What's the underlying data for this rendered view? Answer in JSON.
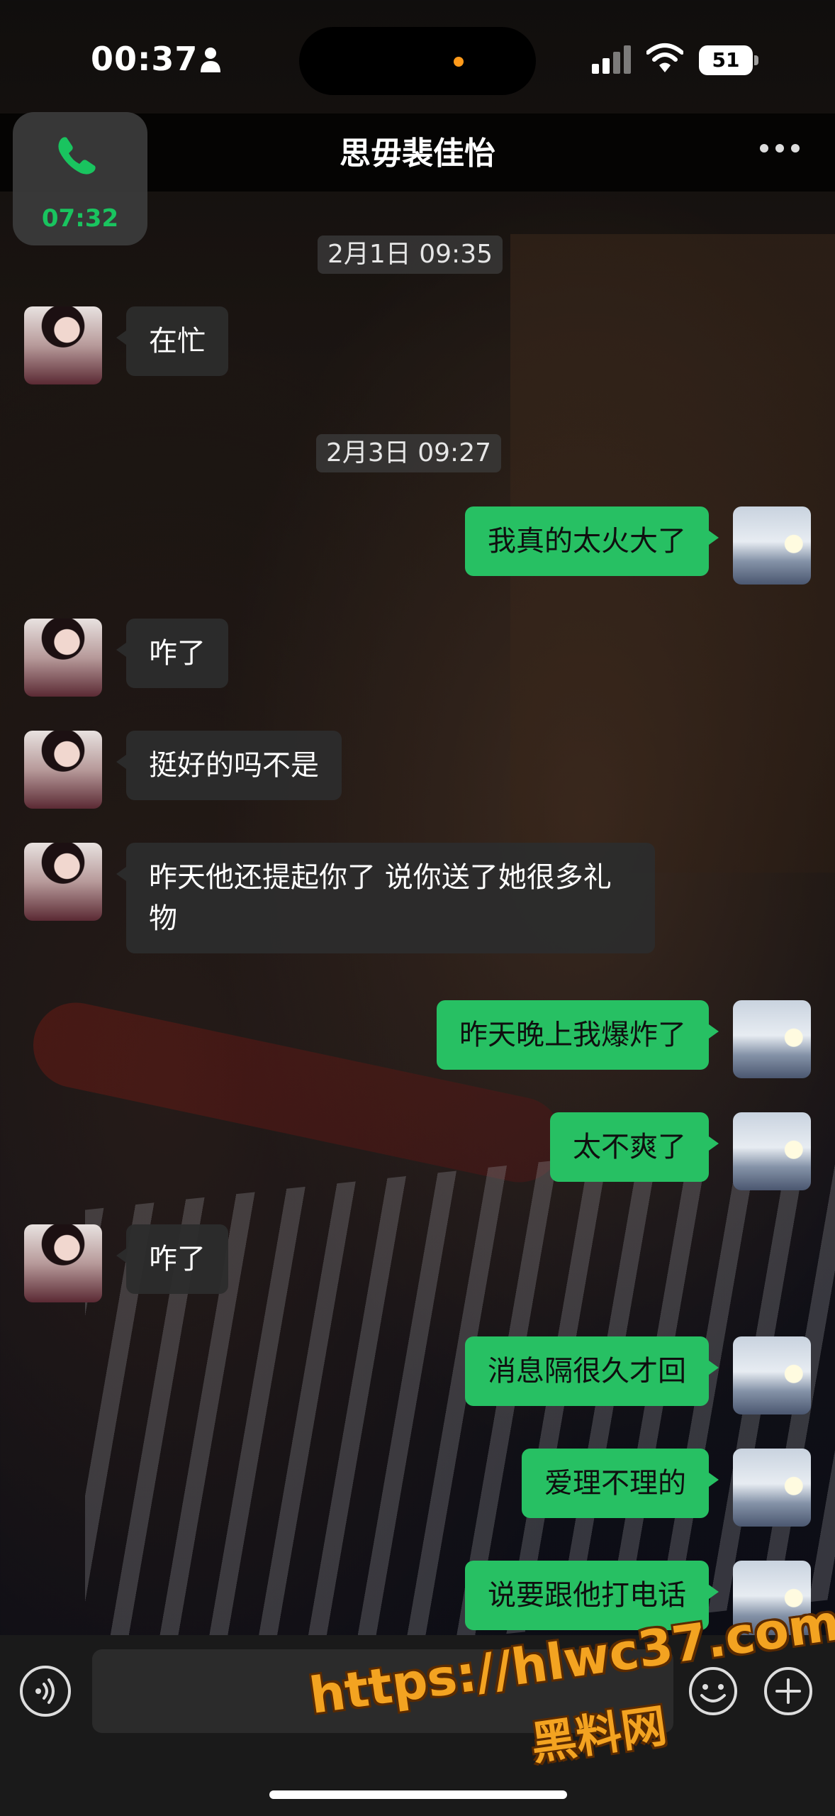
{
  "status_bar": {
    "time": "00:37",
    "battery": "51"
  },
  "header": {
    "title": "思毋裴佳怡",
    "call_duration": "07:32"
  },
  "colors": {
    "accent_green": "#27c063",
    "call_green": "#19c45f",
    "watermark_orange": "#f3a321"
  },
  "icons": {
    "person": "person-icon",
    "signal": "signal-icon",
    "wifi": "wifi-icon",
    "battery": "battery-icon",
    "call": "phone-icon",
    "more": "more-icon",
    "voice": "voice-icon",
    "emoji": "emoji-icon",
    "plus": "plus-icon"
  },
  "messages": [
    {
      "type": "timestamp",
      "text": "2月1日 09:35"
    },
    {
      "type": "in",
      "text": "在忙"
    },
    {
      "type": "timestamp",
      "text": "2月3日 09:27"
    },
    {
      "type": "out",
      "text": "我真的太火大了"
    },
    {
      "type": "in",
      "text": "咋了"
    },
    {
      "type": "in",
      "text": "挺好的吗不是"
    },
    {
      "type": "in",
      "text": "昨天他还提起你了 说你送了她很多礼物"
    },
    {
      "type": "out",
      "text": "昨天晚上我爆炸了"
    },
    {
      "type": "out",
      "text": "太不爽了"
    },
    {
      "type": "in",
      "text": "咋了"
    },
    {
      "type": "out",
      "text": "消息隔很久才回"
    },
    {
      "type": "out",
      "text": "爱理不理的"
    },
    {
      "type": "out",
      "text": "说要跟他打电话"
    }
  ],
  "input": {
    "value": ""
  },
  "watermark": {
    "url": "https://hlwc37.com",
    "name": "黑料网"
  }
}
